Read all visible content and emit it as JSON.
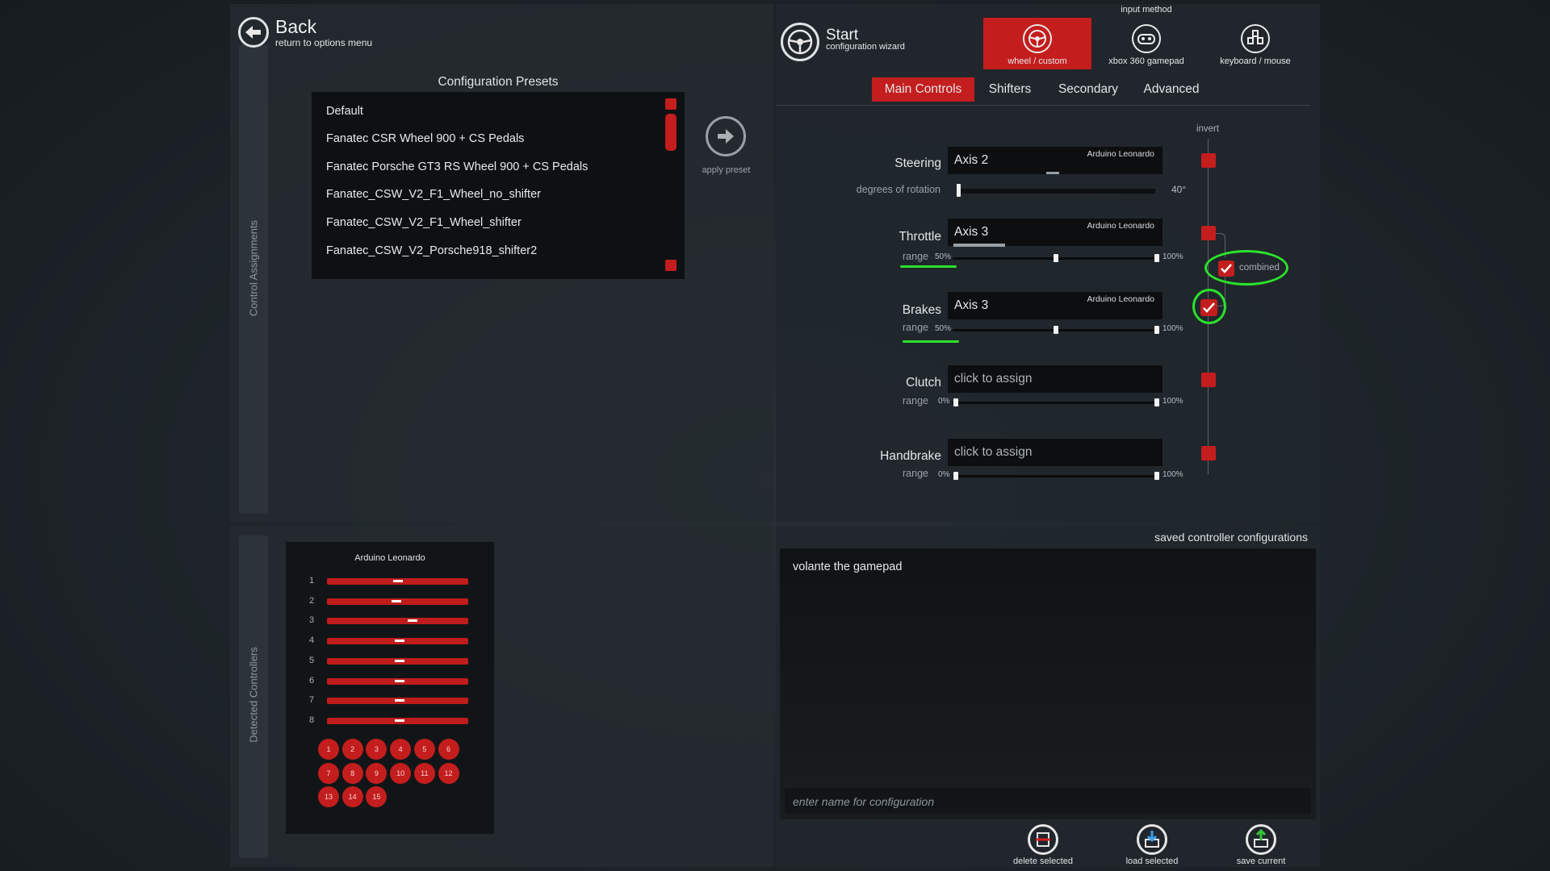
{
  "back": {
    "title": "Back",
    "subtitle": "return to options menu"
  },
  "side_tabs": {
    "control_assignments": "Control Assignments",
    "detected_controllers": "Detected Controllers"
  },
  "presets": {
    "title": "Configuration Presets",
    "items": [
      "Default",
      "Fanatec CSR Wheel 900 + CS Pedals",
      "Fanatec Porsche GT3 RS Wheel 900 + CS Pedals",
      "Fanatec_CSW_V2_F1_Wheel_no_shifter",
      "Fanatec_CSW_V2_F1_Wheel_shifter",
      "Fanatec_CSW_V2_Porsche918_shifter2"
    ],
    "apply_label": "apply preset"
  },
  "start": {
    "title": "Start",
    "subtitle": "configuration wizard"
  },
  "input_method": {
    "title": "input method",
    "options": [
      {
        "label": "wheel / custom",
        "icon": "steering-wheel-icon",
        "selected": true
      },
      {
        "label": "xbox 360 gamepad",
        "icon": "gamepad-icon",
        "selected": false
      },
      {
        "label": "keyboard / mouse",
        "icon": "keyboard-mouse-icon",
        "selected": false
      }
    ]
  },
  "tabs": [
    {
      "label": "Main Controls",
      "active": true
    },
    {
      "label": "Shifters",
      "active": false
    },
    {
      "label": "Secondary",
      "active": false
    },
    {
      "label": "Advanced",
      "active": false
    }
  ],
  "invert_label": "invert",
  "controls": {
    "steering": {
      "label": "Steering",
      "axis": "Axis 2",
      "device": "Arduino Leonardo",
      "sub_label": "degrees of rotation",
      "rotation_value": "40°"
    },
    "throttle": {
      "label": "Throttle",
      "axis": "Axis 3",
      "device": "Arduino Leonardo",
      "range_label": "range",
      "range_min": "50%",
      "range_max": "100%",
      "combined_label": "combined"
    },
    "brakes": {
      "label": "Brakes",
      "axis": "Axis 3",
      "device": "Arduino Leonardo",
      "range_label": "range",
      "range_min": "50%",
      "range_max": "100%"
    },
    "clutch": {
      "label": "Clutch",
      "axis": "click to assign",
      "range_label": "range",
      "range_min": "0%",
      "range_max": "100%"
    },
    "handbrake": {
      "label": "Handbrake",
      "axis": "click to assign",
      "range_label": "range",
      "range_min": "0%",
      "range_max": "100%"
    }
  },
  "detected": {
    "device_name": "Arduino Leonardo",
    "axes": [
      "1",
      "2",
      "3",
      "4",
      "5",
      "6",
      "7",
      "8"
    ],
    "buttons": [
      "1",
      "2",
      "3",
      "4",
      "5",
      "6",
      "7",
      "8",
      "9",
      "10",
      "11",
      "12",
      "13",
      "14",
      "15"
    ]
  },
  "saved": {
    "title": "saved controller configurations",
    "items": [
      "volante the gamepad"
    ],
    "name_placeholder": "enter name for configuration",
    "delete_label": "delete selected",
    "load_label": "load selected",
    "save_label": "save current"
  },
  "colors": {
    "accent_red": "#c41d1d",
    "highlight_green": "#2be12b",
    "panel": "#262d32"
  }
}
